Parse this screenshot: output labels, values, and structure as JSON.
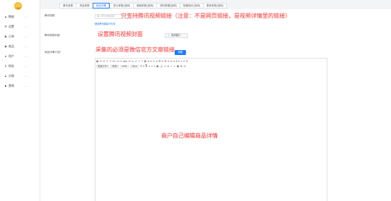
{
  "sidebar": {
    "items": [
      {
        "icon": "chart-icon",
        "glyph": "▲",
        "label": "数据"
      },
      {
        "icon": "gear-icon",
        "glyph": "⚙",
        "label": "设置"
      },
      {
        "icon": "order-icon",
        "glyph": "◉",
        "label": "订单"
      },
      {
        "icon": "product-icon",
        "glyph": "◆",
        "label": "商品"
      },
      {
        "icon": "user-icon",
        "glyph": "●",
        "label": "用户"
      },
      {
        "icon": "finance-icon",
        "glyph": "$",
        "label": "财务"
      },
      {
        "icon": "distribution-icon",
        "glyph": "▲",
        "label": "分销"
      },
      {
        "icon": "marketing-icon",
        "glyph": "■",
        "label": "营销"
      }
    ],
    "arrow": "⌄"
  },
  "tabs": [
    {
      "label": "基本参数",
      "active": false
    },
    {
      "label": "资金参数",
      "active": false
    },
    {
      "label": "商品详情",
      "active": true
    },
    {
      "label": "显示参数(选填)",
      "active": false
    },
    {
      "label": "营销参数(选填)",
      "active": false
    },
    {
      "label": "资料数据(选填)",
      "active": false
    },
    {
      "label": "规格指引(选填)",
      "active": false
    },
    {
      "label": "更新参数(选填)",
      "active": false
    }
  ],
  "form": {
    "video_label": "腾讯视频",
    "video_placeholder": "输入腾讯视频链接",
    "video_help": "使用腾讯链接才可用",
    "cover_label": "腾讯视频封面",
    "upload_button": "选择图片",
    "detail_label": "商品详情介绍*",
    "collect_button": "采集"
  },
  "annotations": {
    "video_note": "只支持腾讯视频链接（注意：不是网页链接，是视频详情里的链接）",
    "cover_note": "设置腾讯视频封面",
    "collect_note": "采集的必须是微信官方文章链接",
    "editor_note": "商户自己编辑商品详情"
  },
  "editor": {
    "toolbar_row1": [
      "▣",
      "⟲",
      "⟳",
      "↶",
      "↷",
      "B",
      "I",
      "U",
      "S",
      "abc",
      "x²",
      "x₂",
      "✐",
      "✂",
      "❝",
      "▤",
      "A",
      "▾",
      "✎",
      "▾",
      "☰",
      "▾",
      "☰",
      "▾",
      "⊡",
      "▾",
      "¶",
      "▾",
      "≡",
      "▾",
      "☷"
    ],
    "toolbar_row2": {
      "heading": "普通文本▾",
      "paragraph": "段落▾",
      "font_family": "arial▾",
      "font_size": "16px▾",
      "buttons": [
        "¶",
        "▾",
        "≣",
        "≡",
        "≡",
        "≡",
        "▦",
        "⚓",
        "∞",
        "⊘",
        "⌂",
        "☺",
        "▣",
        "⊞",
        "⊡"
      ]
    },
    "caret_text": "ᵢ"
  },
  "colors": {
    "accent": "#1e7bff",
    "annotation": "#ff2d2d",
    "avatar": "#f7c948"
  }
}
